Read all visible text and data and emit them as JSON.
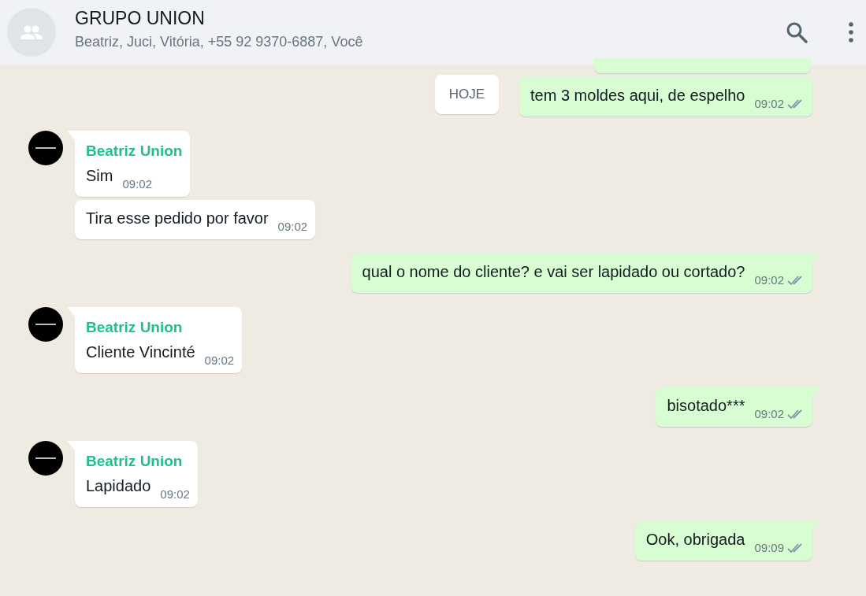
{
  "header": {
    "title": "GRUPO UNION",
    "members": "Beatriz, Juci, Vitória, +55 92 9370-6887, Você"
  },
  "date_chip": "HOJE",
  "messages": [
    {
      "kind": "out",
      "text": "tem 3 moldes aqui, de espelho",
      "time": "09:02",
      "read": false,
      "tail": false
    },
    {
      "kind": "in",
      "sender": "Beatriz Union",
      "text": "Sim",
      "time": "09:02",
      "tail": true
    },
    {
      "kind": "in",
      "text": "Tira esse pedido por favor",
      "time": "09:02",
      "tail": false
    },
    {
      "kind": "out",
      "text": "qual o nome do cliente? e vai ser lapidado ou cortado?",
      "time": "09:02",
      "read": false,
      "tail": true
    },
    {
      "kind": "in",
      "sender": "Beatriz Union",
      "text": "Cliente Vincinté",
      "time": "09:02",
      "tail": true
    },
    {
      "kind": "out",
      "text": "bisotado***",
      "time": "09:02",
      "read": false,
      "tail": true
    },
    {
      "kind": "in",
      "sender": "Beatriz Union",
      "text": "Lapidado",
      "time": "09:02",
      "tail": true
    },
    {
      "kind": "out",
      "text": "Ook, obrigada",
      "time": "09:09",
      "read": false,
      "tail": true
    }
  ]
}
